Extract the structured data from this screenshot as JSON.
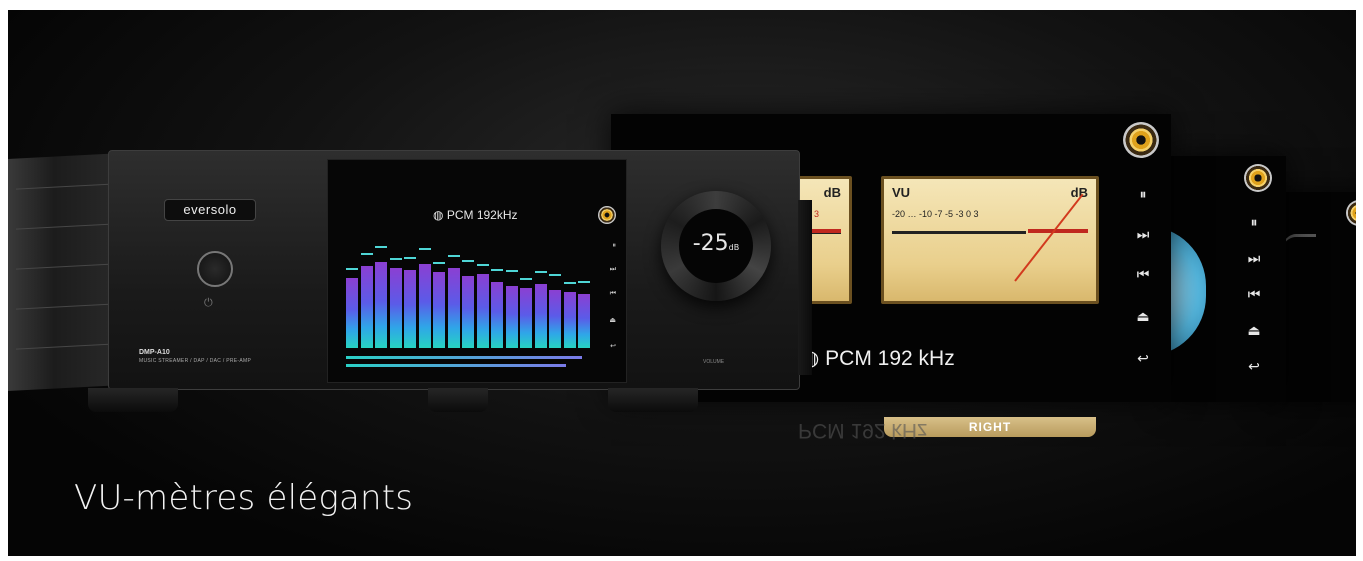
{
  "caption": "VU-mètres élégants",
  "device": {
    "brand": "eversolo",
    "model": "DMP-A10",
    "model_desc": "MUSIC STREAMER / DAP / DAC / PRE-AMP",
    "power_glyph": "⏻",
    "screen_format": "PCM  192kHz",
    "volume_value": "-25",
    "volume_unit": "dB",
    "volume_label": "VOLUME"
  },
  "vu": {
    "left_db": "dB",
    "right_vu": "VU",
    "right_db": "dB",
    "scale": "-20 … -10 -7 -5 -3  0  3",
    "scale_left_tail": "3",
    "right_label": "RIGHT",
    "format": "PCM  192 kHz",
    "format_reflection": "PCM  192 kHz"
  },
  "controls": {
    "pause": "⏸",
    "next": "⏭",
    "prev": "⏮",
    "eject": "⏏",
    "back": "↩"
  },
  "colors": {
    "bar_top": "#8b3fd2",
    "bar_bottom": "#27d3c1",
    "needle": "#d23a1e",
    "meter_face": "#f5e6b8"
  }
}
